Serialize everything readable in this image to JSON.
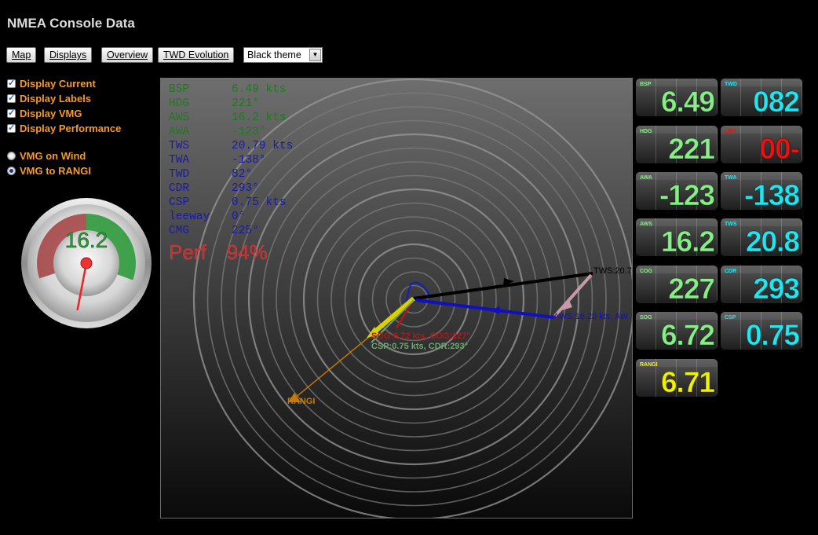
{
  "app": {
    "title": "NMEA Console Data"
  },
  "toolbar": {
    "buttons": [
      "Map",
      "Displays",
      "Overview",
      "TWD Evolution"
    ],
    "theme_select": {
      "value": "Black theme"
    }
  },
  "options": {
    "checkboxes": [
      {
        "label": "Display Current",
        "checked": true
      },
      {
        "label": "Display Labels",
        "checked": true
      },
      {
        "label": "Display VMG",
        "checked": true
      },
      {
        "label": "Display Performance",
        "checked": true
      }
    ],
    "radios": [
      {
        "label": "VMG on Wind",
        "checked": false
      },
      {
        "label": "VMG to RANGI",
        "checked": true
      }
    ]
  },
  "gauge": {
    "value": "16.2",
    "needle_value": 16.2
  },
  "data_panel": {
    "rows": [
      {
        "label": "BSP",
        "value": "6.49 kts",
        "color": "#1f7a1f"
      },
      {
        "label": "HDG",
        "value": "221°",
        "color": "#1f7a1f"
      },
      {
        "label": "AWS",
        "value": "16.2 kts",
        "color": "#1f7a1f"
      },
      {
        "label": "AWA",
        "value": "-123°",
        "color": "#1f7a1f"
      },
      {
        "label": "TWS",
        "value": "20.79 kts",
        "color": "#1a1aa8"
      },
      {
        "label": "TWA",
        "value": "-138°",
        "color": "#1a1aa8"
      },
      {
        "label": "TWD",
        "value": "82°",
        "color": "#1a1aa8"
      },
      {
        "label": "CDR",
        "value": "293°",
        "color": "#1a1aa8"
      },
      {
        "label": "CSP",
        "value": "0.75 kts",
        "color": "#1a1aa8"
      },
      {
        "label": "leeway",
        "value": "0°",
        "color": "#1a1aa8"
      },
      {
        "label": "CMG",
        "value": "225°",
        "color": "#1a1aa8"
      }
    ],
    "perf": {
      "label": "Perf",
      "value": "94%"
    }
  },
  "compass_labels": {
    "tws": "TWS:20.7",
    "aws": "AWS:16.20 kts, AW",
    "cog": "SOG:6.72 kts, COG:227°",
    "csp": "CSP:0.75 kts, CDR:293°",
    "rangi": "RANGI"
  },
  "colors": {
    "tws_arrow": "#000000",
    "aws_arrow": "#1010c0",
    "current_arrow": "#c89aa8",
    "vmg_arrow": "#d8d000",
    "rangi_line": "#c87a00",
    "boat_outline": "#1020c0",
    "green_text": "#88ee88",
    "cyan_text": "#22e5ef",
    "red_text": "#ee1111",
    "yellow_text": "#f2f200"
  },
  "tiles": [
    {
      "label": "BSP",
      "value": "6.49",
      "color": "#88ee88"
    },
    {
      "label": "TWD",
      "value": "082",
      "color": "#22e5ef"
    },
    {
      "label": "HDG",
      "value": "221",
      "color": "#88ee88"
    },
    {
      "label": "LWY",
      "value": "00-",
      "color": "#ee1111"
    },
    {
      "label": "AWA",
      "value": "-123",
      "color": "#88ee88"
    },
    {
      "label": "TWA",
      "value": "-138",
      "color": "#22e5ef"
    },
    {
      "label": "AWS",
      "value": "16.2",
      "color": "#88ee88"
    },
    {
      "label": "TWS",
      "value": "20.8",
      "color": "#22e5ef"
    },
    {
      "label": "COG",
      "value": "227",
      "color": "#88ee88"
    },
    {
      "label": "CDR",
      "value": "293",
      "color": "#22e5ef"
    },
    {
      "label": "SOG",
      "value": "6.72",
      "color": "#88ee88"
    },
    {
      "label": "CSP",
      "value": "0.75",
      "color": "#22e5ef"
    },
    {
      "label": "RANGI",
      "value": "6.71",
      "color": "#f2f200"
    }
  ]
}
